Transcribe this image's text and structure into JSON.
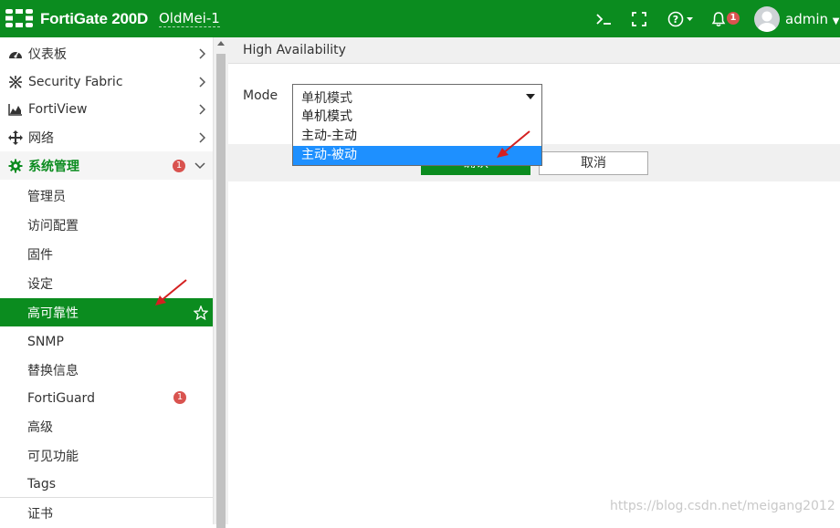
{
  "topbar": {
    "brand": "FortiGate 200D",
    "hostname": "OldMei-1",
    "notification_count": "1",
    "user": "admin"
  },
  "sidebar": {
    "items": [
      {
        "label": "仪表板",
        "icon": "dashboard-icon"
      },
      {
        "label": "Security Fabric",
        "icon": "fabric-icon"
      },
      {
        "label": "FortiView",
        "icon": "chart-icon"
      },
      {
        "label": "网络",
        "icon": "move-icon"
      },
      {
        "label": "系统管理",
        "icon": "gear-icon",
        "badge": "1"
      }
    ],
    "subitems": [
      {
        "label": "管理员"
      },
      {
        "label": "访问配置"
      },
      {
        "label": "固件"
      },
      {
        "label": "设定"
      },
      {
        "label": "高可靠性"
      },
      {
        "label": "SNMP"
      },
      {
        "label": "替换信息"
      },
      {
        "label": "FortiGuard",
        "badge": "1"
      },
      {
        "label": "高级"
      },
      {
        "label": "可见功能"
      },
      {
        "label": "Tags"
      }
    ],
    "bottom_item": {
      "label": "证书"
    }
  },
  "content": {
    "title": "High Availability",
    "mode_label": "Mode",
    "mode_value": "单机模式",
    "options": [
      "单机模式",
      "主动-主动",
      "主动-被动"
    ],
    "ok_label": "确认",
    "cancel_label": "取消"
  },
  "watermark": "https://blog.csdn.net/meigang2012",
  "colors": {
    "brand_green": "#0b8c1f",
    "highlight_blue": "#1e90ff",
    "badge_red": "#d9534f"
  }
}
